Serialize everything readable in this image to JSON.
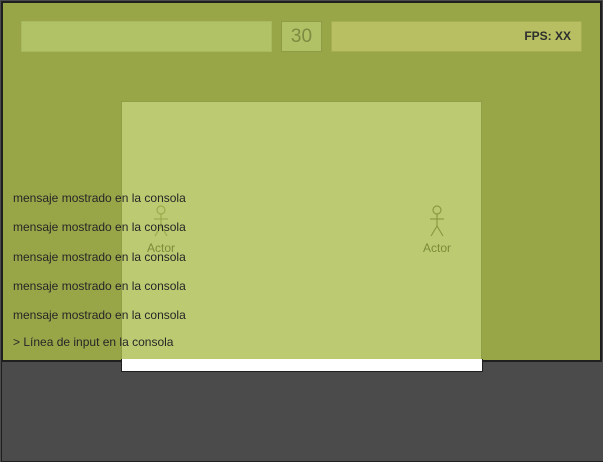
{
  "hud": {
    "counter": "30",
    "fps_label": "FPS: XX"
  },
  "actors": [
    {
      "label": "Actor",
      "icon": "stick-figure-icon"
    },
    {
      "label": "Actor",
      "icon": "stick-figure-icon"
    }
  ],
  "console": {
    "messages": [
      "mensaje mostrado en la consola",
      "mensaje mostrado en la consola",
      "mensaje mostrado en la consola",
      "mensaje mostrado en la consola",
      "mensaje mostrado en la consola"
    ],
    "input_line": "> Línea de input en la consola"
  },
  "colors": {
    "game_background": "#98a648",
    "world_panel": "#bccb72",
    "hud_box": "#b1c266",
    "bottom_panel": "#4b4b4b"
  }
}
